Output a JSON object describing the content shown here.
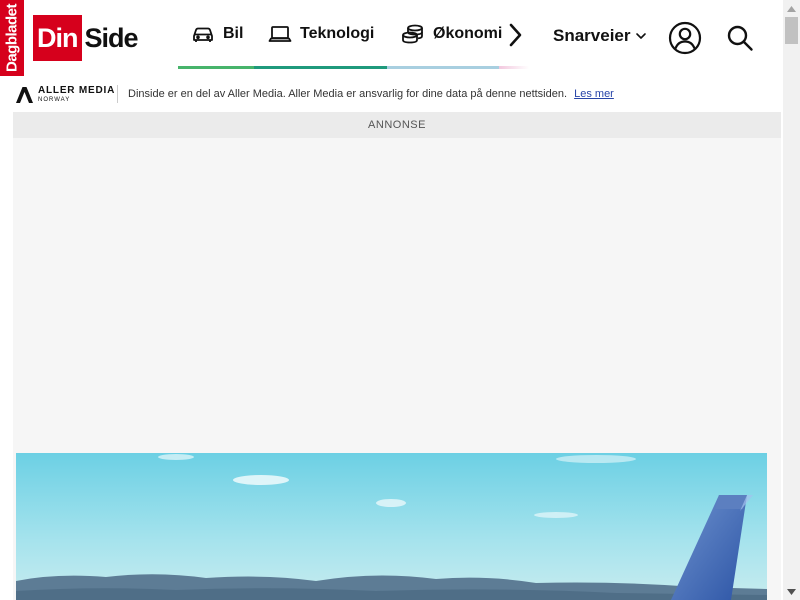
{
  "header": {
    "dagbladet_logo": "Dagbladet",
    "dinside_logo": {
      "part1": "Din",
      "part2": "Side"
    },
    "nav": [
      {
        "label": "Bil",
        "icon": "car-icon"
      },
      {
        "label": "Teknologi",
        "icon": "laptop-icon"
      },
      {
        "label": "Økonomi",
        "icon": "coins-icon"
      }
    ],
    "nav_next_icon": "chevron-right-icon",
    "shortcuts_label": "Snarveier",
    "user_icon": "user-icon",
    "search_icon": "search-icon",
    "colors": {
      "brand_red": "#d6001c",
      "nav_bil": "#47b46b",
      "nav_teknologi": "#1f9a7c",
      "nav_okonomi": "#a8cfe0"
    }
  },
  "aller": {
    "logo_name": "ALLER MEDIA",
    "logo_sub": "NORWAY",
    "info_text": "Dinside er en del av Aller Media. Aller Media er ansvarlig for dine data på denne nettsiden.",
    "link_text": "Les mer"
  },
  "ad": {
    "label": "ANNONSE"
  }
}
